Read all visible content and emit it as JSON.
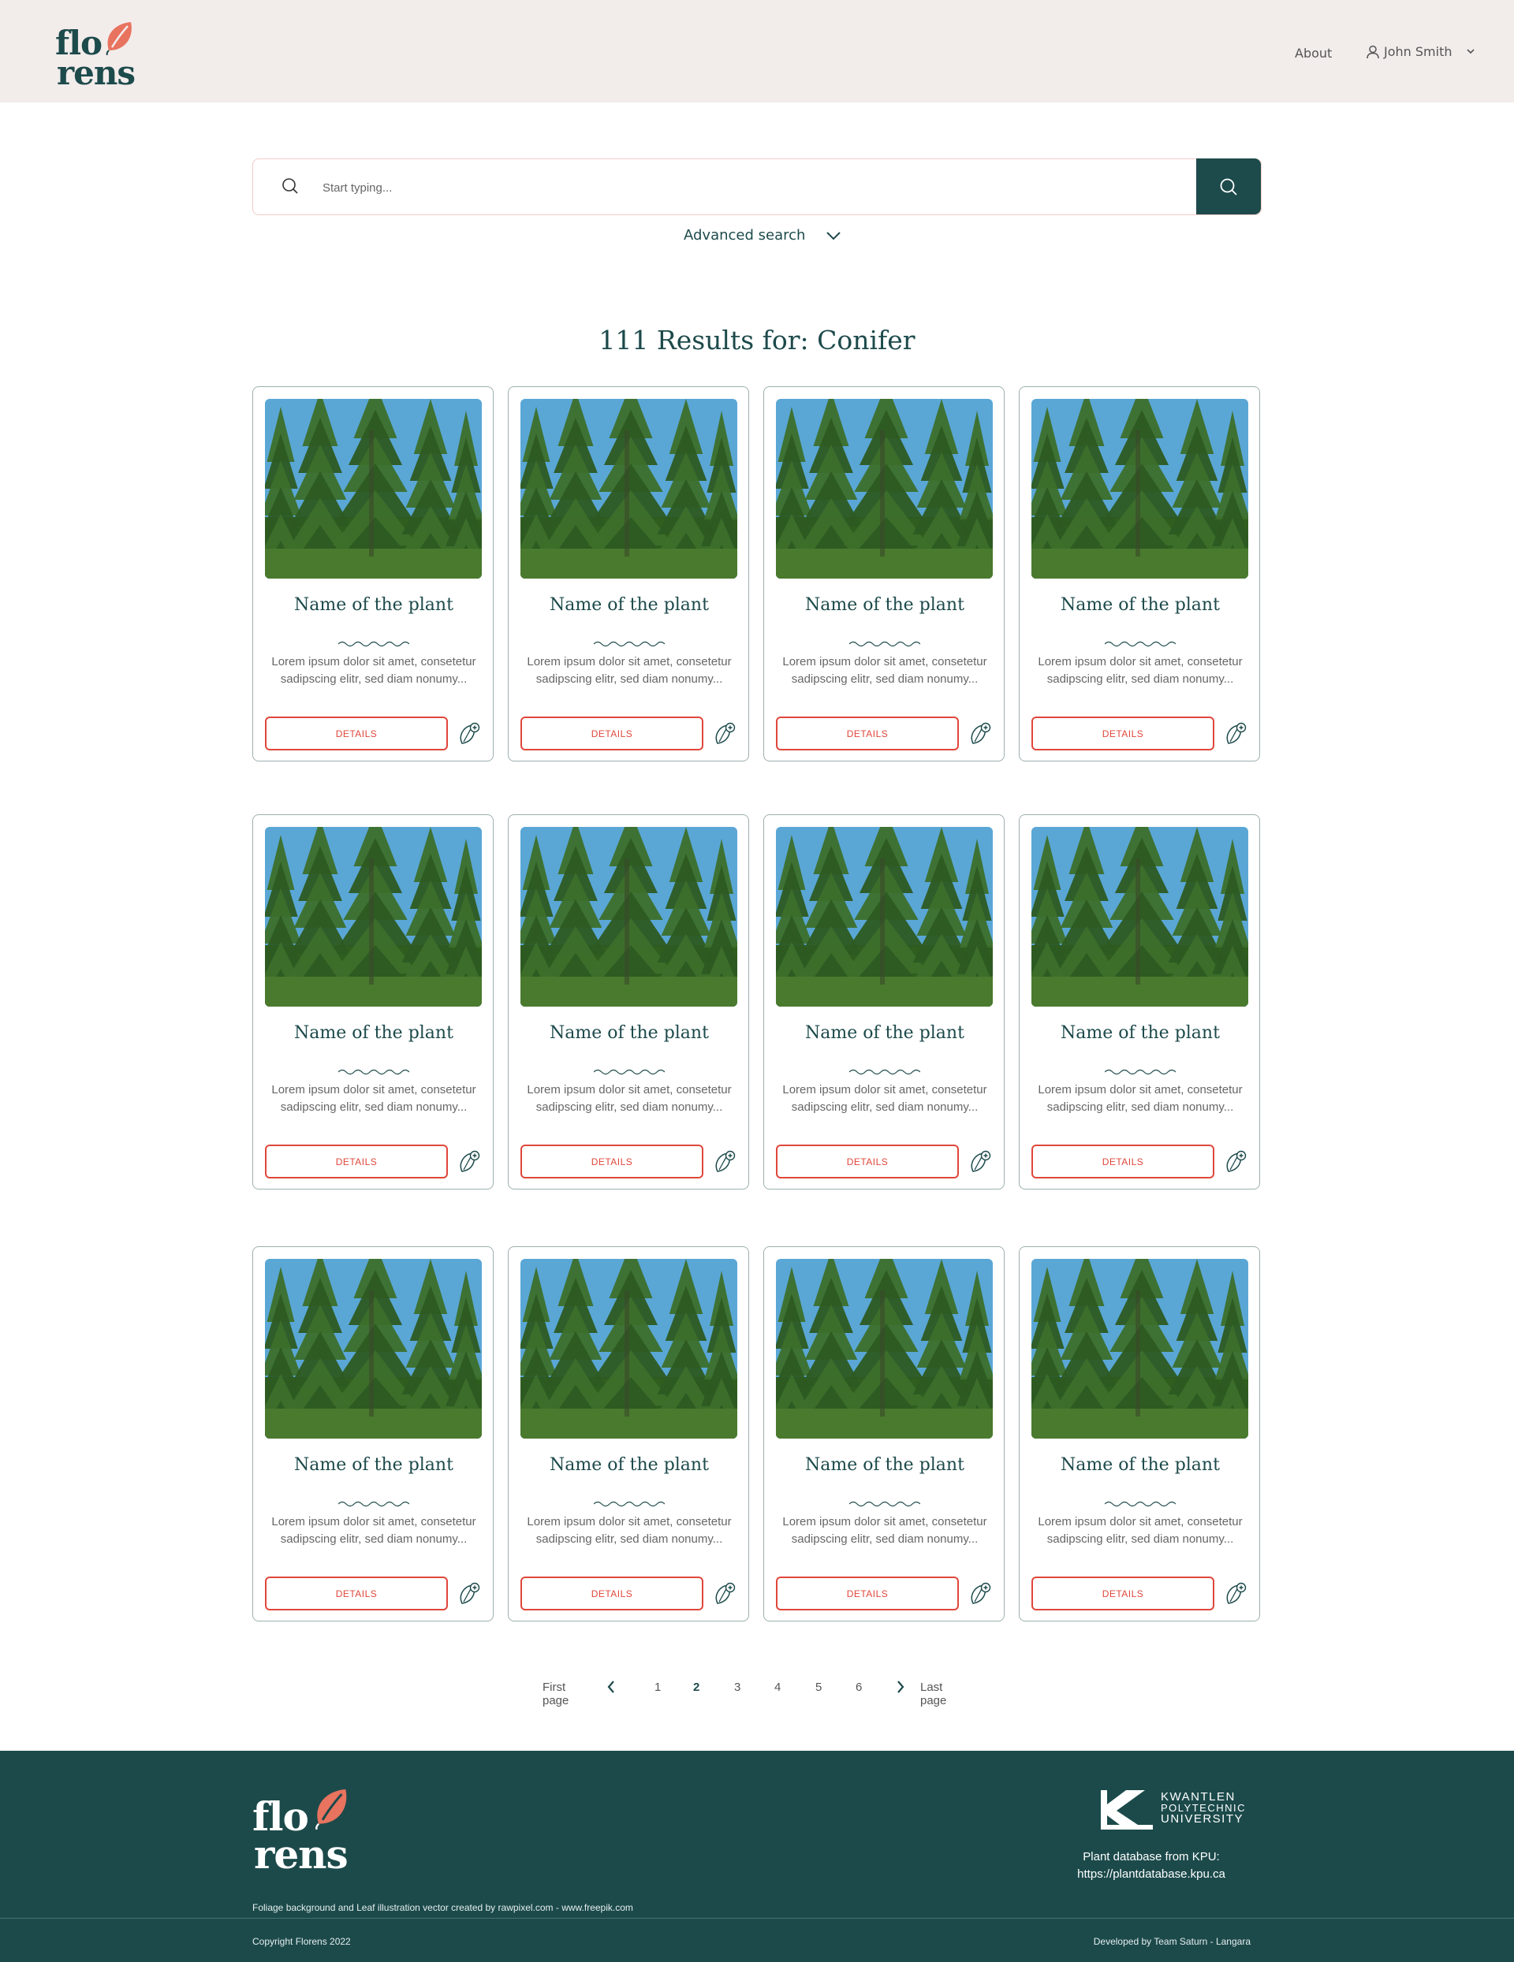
{
  "header": {
    "logo_line1": "flo",
    "logo_line2": "rens",
    "nav_about": "About",
    "user_name": "John Smith"
  },
  "search": {
    "placeholder": "Start typing...",
    "value": "",
    "advanced_label": "Advanced search"
  },
  "results": {
    "title": "111 Results for: Conifer"
  },
  "cards": [
    {
      "name": "Name of the plant",
      "desc": "Lorem ipsum dolor sit amet, consetetur sadipscing elitr, sed diam nonumy...",
      "details": "DETAILS"
    },
    {
      "name": "Name of the plant",
      "desc": "Lorem ipsum dolor sit amet, consetetur sadipscing elitr, sed diam nonumy...",
      "details": "DETAILS"
    },
    {
      "name": "Name of the plant",
      "desc": "Lorem ipsum dolor sit amet, consetetur sadipscing elitr, sed diam nonumy...",
      "details": "DETAILS"
    },
    {
      "name": "Name of the plant",
      "desc": "Lorem ipsum dolor sit amet, consetetur sadipscing elitr, sed diam nonumy...",
      "details": "DETAILS"
    },
    {
      "name": "Name of the plant",
      "desc": "Lorem ipsum dolor sit amet, consetetur sadipscing elitr, sed diam nonumy...",
      "details": "DETAILS"
    },
    {
      "name": "Name of the plant",
      "desc": "Lorem ipsum dolor sit amet, consetetur sadipscing elitr, sed diam nonumy...",
      "details": "DETAILS"
    },
    {
      "name": "Name of the plant",
      "desc": "Lorem ipsum dolor sit amet, consetetur sadipscing elitr, sed diam nonumy...",
      "details": "DETAILS"
    },
    {
      "name": "Name of the plant",
      "desc": "Lorem ipsum dolor sit amet, consetetur sadipscing elitr, sed diam nonumy...",
      "details": "DETAILS"
    },
    {
      "name": "Name of the plant",
      "desc": "Lorem ipsum dolor sit amet, consetetur sadipscing elitr, sed diam nonumy...",
      "details": "DETAILS"
    },
    {
      "name": "Name of the plant",
      "desc": "Lorem ipsum dolor sit amet, consetetur sadipscing elitr, sed diam nonumy...",
      "details": "DETAILS"
    },
    {
      "name": "Name of the plant",
      "desc": "Lorem ipsum dolor sit amet, consetetur sadipscing elitr, sed diam nonumy...",
      "details": "DETAILS"
    },
    {
      "name": "Name of the plant",
      "desc": "Lorem ipsum dolor sit amet, consetetur sadipscing elitr, sed diam nonumy...",
      "details": "DETAILS"
    }
  ],
  "pagination": {
    "first": "First page",
    "last": "Last page",
    "pages": [
      "1",
      "2",
      "3",
      "4",
      "5",
      "6"
    ],
    "current": "2"
  },
  "footer": {
    "logo_line1": "flo",
    "logo_line2": "rens",
    "credit": "Foliage background and Leaf illustration vector created by rawpixel.com - www.freepik.com",
    "kpu_line1": "KWANTLEN",
    "kpu_line2": "POLYTECHNIC",
    "kpu_line3": "UNIVERSITY",
    "kpu_text1": "Plant database from KPU:",
    "kpu_text2": "https://plantdatabase.kpu.ca",
    "copyright": "Copyright Florens 2022",
    "developed_by": "Developed by Team Saturn - Langara"
  },
  "colors": {
    "brand_dark": "#1d4a4b",
    "accent_red": "#e0473b",
    "header_bg": "#f2eceb",
    "logo_leaf": "#e8735f"
  },
  "icons": {
    "search": "search-icon",
    "user": "user-icon",
    "chevron": "chevron-down-icon",
    "favorite": "leaf-plus-icon"
  }
}
